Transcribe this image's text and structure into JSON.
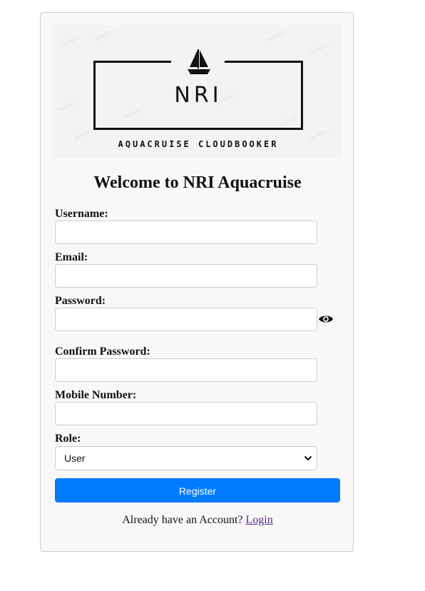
{
  "logo": {
    "brand": "NRI",
    "tagline": "AQUACRUISE CLOUDBOOKER",
    "watermark": "Sedago..."
  },
  "title": "Welcome to NRI Aquacruise",
  "fields": {
    "username": {
      "label": "Username:",
      "value": ""
    },
    "email": {
      "label": "Email:",
      "value": ""
    },
    "password": {
      "label": "Password:",
      "value": "",
      "toggle_icon": "eye-icon"
    },
    "confirm_password": {
      "label": "Confirm Password:",
      "value": ""
    },
    "mobile": {
      "label": "Mobile Number:",
      "value": ""
    },
    "role": {
      "label": "Role:",
      "value": "User"
    }
  },
  "register_button": "Register",
  "footer": {
    "text": "Already have an Account?",
    "link": "Login"
  },
  "colors": {
    "primary": "#007bff",
    "link": "#5a2a82",
    "card_bg": "#f8f8f8"
  }
}
